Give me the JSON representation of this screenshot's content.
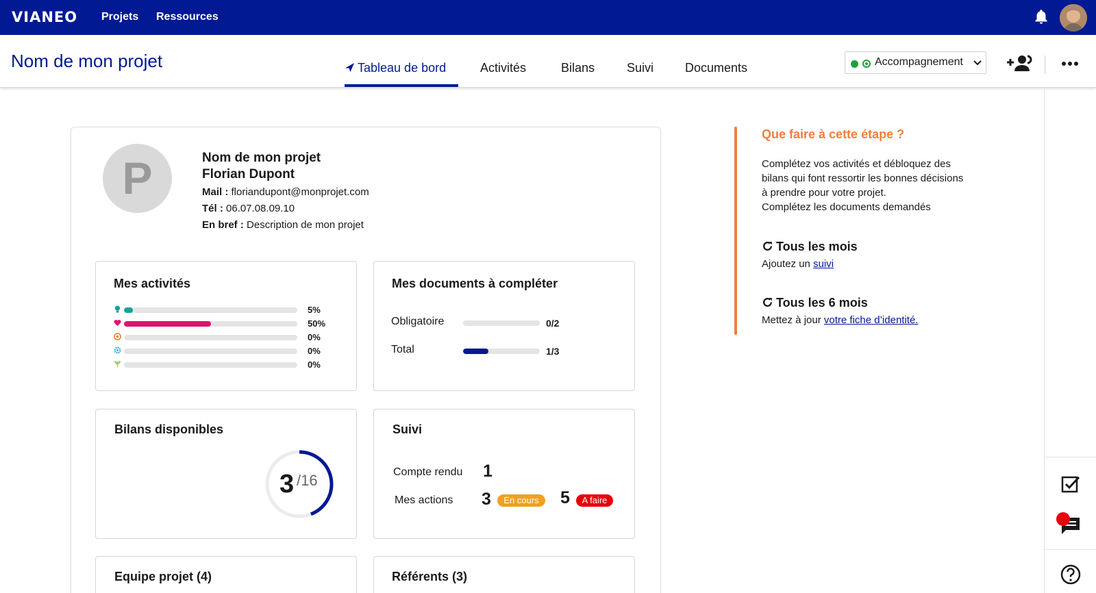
{
  "topbar": {
    "logo": "VIANEO",
    "nav": [
      "Projets",
      "Ressources"
    ]
  },
  "project": {
    "title": "Nom de mon projet",
    "tabs": [
      "Tableau de bord",
      "Activités",
      "Bilans",
      "Suivi",
      "Documents"
    ],
    "active_tab": "Tableau de bord",
    "status": "Accompagnement"
  },
  "profile": {
    "initial": "P",
    "name": "Nom de mon projet",
    "person": "Florian Dupont",
    "mail_label": "Mail :",
    "mail": "floriandupont@monprojet.com",
    "tel_label": "Tél :",
    "tel": "06.07.08.09.10",
    "bref_label": "En bref :",
    "bref": "Description de mon projet"
  },
  "activites": {
    "title": "Mes activités",
    "rows": [
      {
        "icon": "lightbulb-icon",
        "value": 0.05,
        "label": "5%",
        "color": "#16a39b"
      },
      {
        "icon": "heart-icon",
        "value": 0.5,
        "label": "50%",
        "color": "#e2116f"
      },
      {
        "icon": "globe-icon",
        "value": 0.0,
        "label": "0%",
        "color": "#f07f3c"
      },
      {
        "icon": "gear-icon",
        "value": 0.0,
        "label": "0%",
        "color": "#1ea6d8"
      },
      {
        "icon": "plant-icon",
        "value": 0.0,
        "label": "0%",
        "color": "#8bc34a"
      }
    ]
  },
  "documents": {
    "title": "Mes documents à compléter",
    "rows": [
      {
        "label": "Obligatoire",
        "done": 0,
        "total": 2,
        "count": "0/2"
      },
      {
        "label": "Total",
        "done": 1,
        "total": 3,
        "count": "1/3"
      }
    ]
  },
  "bilans": {
    "title": "Bilans disponibles",
    "available": 3,
    "total": 16,
    "available_text": "3",
    "total_text": "/16"
  },
  "suivi": {
    "title": "Suivi",
    "compte_rendu_label": "Compte rendu",
    "compte_rendu_value": "1",
    "actions_label": "Mes actions",
    "en_cours_value": "3",
    "en_cours_label": "En cours",
    "a_faire_value": "5",
    "a_faire_label": "A faire",
    "colors": {
      "en_cours": "#f0a11e",
      "a_faire": "#e8000b"
    }
  },
  "equipe": {
    "title": "Equipe projet (4)"
  },
  "referents": {
    "title": "Référents (3)"
  },
  "help": {
    "title": "Que faire à cette étape ?",
    "lines": [
      "Complétez vos activités et débloquez des",
      "bilans qui font ressortir les bonnes décisions",
      "à prendre pour votre projet.",
      "Complétez les documents demandés"
    ],
    "monthly_title": "Tous les mois",
    "monthly_text": "Ajoutez un",
    "monthly_link": "suivi",
    "six_title": "Tous les 6 mois",
    "six_text": "Mettez à jour",
    "six_link": "votre fiche d’identité."
  },
  "colors": {
    "brand": "#011993",
    "accent": "#f07f3c"
  }
}
